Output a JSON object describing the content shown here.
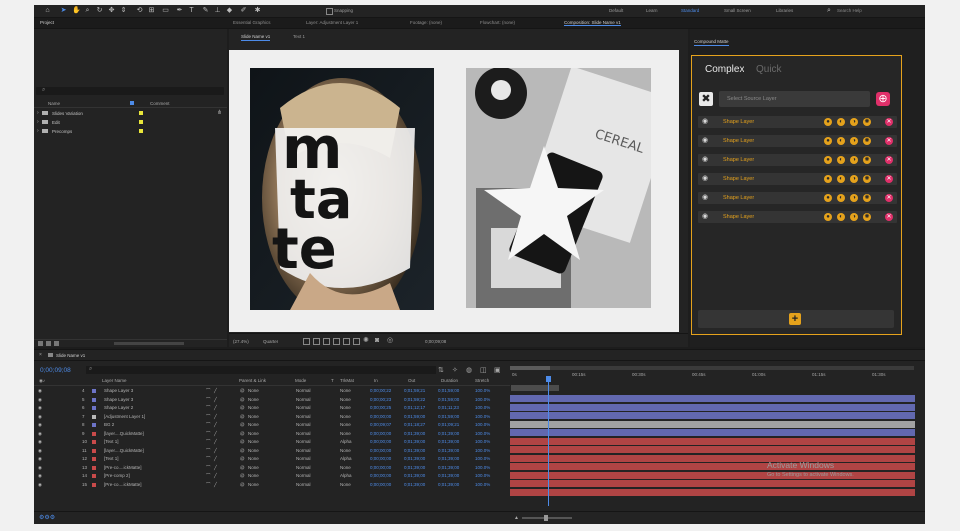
{
  "toolbar": {
    "snapping_label": "Snapping",
    "workspaces": [
      "Default",
      "Learn",
      "Standard",
      "Small Screen",
      "Libraries"
    ],
    "active_workspace": "Standard",
    "search_placeholder": "Search Help"
  },
  "panel_tabs": {
    "project": "Project",
    "essential_graphics": "Essential Graphics",
    "layer": "Layer: Adjustment Layer 1",
    "footage": "Footage: (none)",
    "flowchart": "Flowchart: (none)",
    "composition": "Composition: Slide Name v1",
    "compound_matte": "Compound Matte"
  },
  "viewer_tabs": [
    "Slide Name v1",
    "Text 1"
  ],
  "project": {
    "search_placeholder": "",
    "col_name": "Name",
    "col_comment": "Comment",
    "items": [
      {
        "name": "Slides Variation"
      },
      {
        "name": "Edit"
      },
      {
        "name": "Precomps"
      }
    ]
  },
  "viewer_footer": {
    "zoom": "(27.4%)",
    "resolution": "Quarter",
    "timecode": "0;00;09;08"
  },
  "compound_matte": {
    "mode_complex": "Complex",
    "mode_quick": "Quick",
    "source_placeholder": "Select Source Layer",
    "layers": [
      "Shape Layer",
      "Shape Layer",
      "Shape Layer",
      "Shape Layer",
      "Shape Layer",
      "Shape Layer"
    ],
    "add_icon": "plus-icon",
    "accent": "#e5a21c",
    "danger": "#e0306a"
  },
  "timeline": {
    "comp_tab": "Slide Name v1",
    "timecode": "0;00;09;08",
    "header": {
      "layer_name": "Layer Name",
      "parent": "Parent & Link",
      "mode": "Mode",
      "t": "T",
      "trkmat": "TrkMat",
      "in": "In",
      "out": "Out",
      "duration": "Duration",
      "stretch": "Stretch"
    },
    "ruler": [
      "0s",
      "00:15s",
      "00:30s",
      "00:45s",
      "01:00s",
      "01:15s",
      "01:30s"
    ],
    "layers": [
      {
        "num": "4",
        "name": "Shape Layer 3",
        "parent": "None",
        "mode": "Normal",
        "trk": "None",
        "in": "0;00;00;22",
        "out": "0;01;59;21",
        "dur": "0;01;59;00",
        "stretch": "100.0%",
        "color": "#6d74c8"
      },
      {
        "num": "5",
        "name": "Shape Layer 3",
        "parent": "None",
        "mode": "Normal",
        "trk": "None",
        "in": "0;00;00;23",
        "out": "0;01;59;22",
        "dur": "0;01;59;00",
        "stretch": "100.0%",
        "color": "#6d74c8"
      },
      {
        "num": "6",
        "name": "Shape Layer 2",
        "parent": "None",
        "mode": "Normal",
        "trk": "None",
        "in": "0;00;00;25",
        "out": "0;01;12;17",
        "dur": "0;01;11;23",
        "stretch": "100.0%",
        "color": "#6d74c8"
      },
      {
        "num": "7",
        "name": "[Adjustment Layer 1]",
        "parent": "None",
        "mode": "Normal",
        "trk": "None",
        "in": "0;00;00;00",
        "out": "0;01;59;00",
        "dur": "0;01;59;00",
        "stretch": "100.0%",
        "color": "#b9b9b9"
      },
      {
        "num": "8",
        "name": "BG 2",
        "parent": "None",
        "mode": "Normal",
        "trk": "None",
        "in": "0;00;09;07",
        "out": "0;01;18;27",
        "dur": "0;01;09;21",
        "stretch": "100.0%",
        "color": "#6d74c8"
      },
      {
        "num": "9",
        "name": "[layer....QuickMatte]",
        "parent": "None",
        "mode": "Normal",
        "trk": "None",
        "in": "0;00;00;00",
        "out": "0;01;39;00",
        "dur": "0;01;39;00",
        "stretch": "100.0%",
        "color": "#c94a4a"
      },
      {
        "num": "10",
        "name": "[Text 1]",
        "parent": "None",
        "mode": "Normal",
        "trk": "Alpha",
        "in": "0;00;00;00",
        "out": "0;01;39;00",
        "dur": "0;01;39;00",
        "stretch": "100.0%",
        "color": "#c94a4a"
      },
      {
        "num": "11",
        "name": "[layer....QuickMatte]",
        "parent": "None",
        "mode": "Normal",
        "trk": "None",
        "in": "0;00;00;00",
        "out": "0;01;39;00",
        "dur": "0;01;39;00",
        "stretch": "100.0%",
        "color": "#c94a4a"
      },
      {
        "num": "12",
        "name": "[Text 1]",
        "parent": "None",
        "mode": "Normal",
        "trk": "Alpha",
        "in": "0;00;00;00",
        "out": "0;01;39;00",
        "dur": "0;01;39;00",
        "stretch": "100.0%",
        "color": "#c94a4a"
      },
      {
        "num": "13",
        "name": "[Pre-co....ickMatte]",
        "parent": "None",
        "mode": "Normal",
        "trk": "None",
        "in": "0;00;00;00",
        "out": "0;01;39;00",
        "dur": "0;01;39;00",
        "stretch": "100.0%",
        "color": "#c94a4a"
      },
      {
        "num": "14",
        "name": "[Pre-comp 2]",
        "parent": "None",
        "mode": "Normal",
        "trk": "Alpha",
        "in": "0;00;00;00",
        "out": "0;01;39;00",
        "dur": "0;01;39;00",
        "stretch": "100.0%",
        "color": "#c94a4a"
      },
      {
        "num": "15",
        "name": "[Pre-co....ickMatte]",
        "parent": "None",
        "mode": "Normal",
        "trk": "None",
        "in": "0;00;00;00",
        "out": "0;01;39;00",
        "dur": "0;01;39;00",
        "stretch": "100.0%",
        "color": "#c94a4a"
      }
    ]
  },
  "watermark": {
    "line1": "Activate Windows",
    "line2": "Go to Settings to activate Windows."
  },
  "art": {
    "poster_text_lines": [
      "m",
      "ta",
      "te",
      "te"
    ],
    "cereal_text": "CEREAL"
  }
}
